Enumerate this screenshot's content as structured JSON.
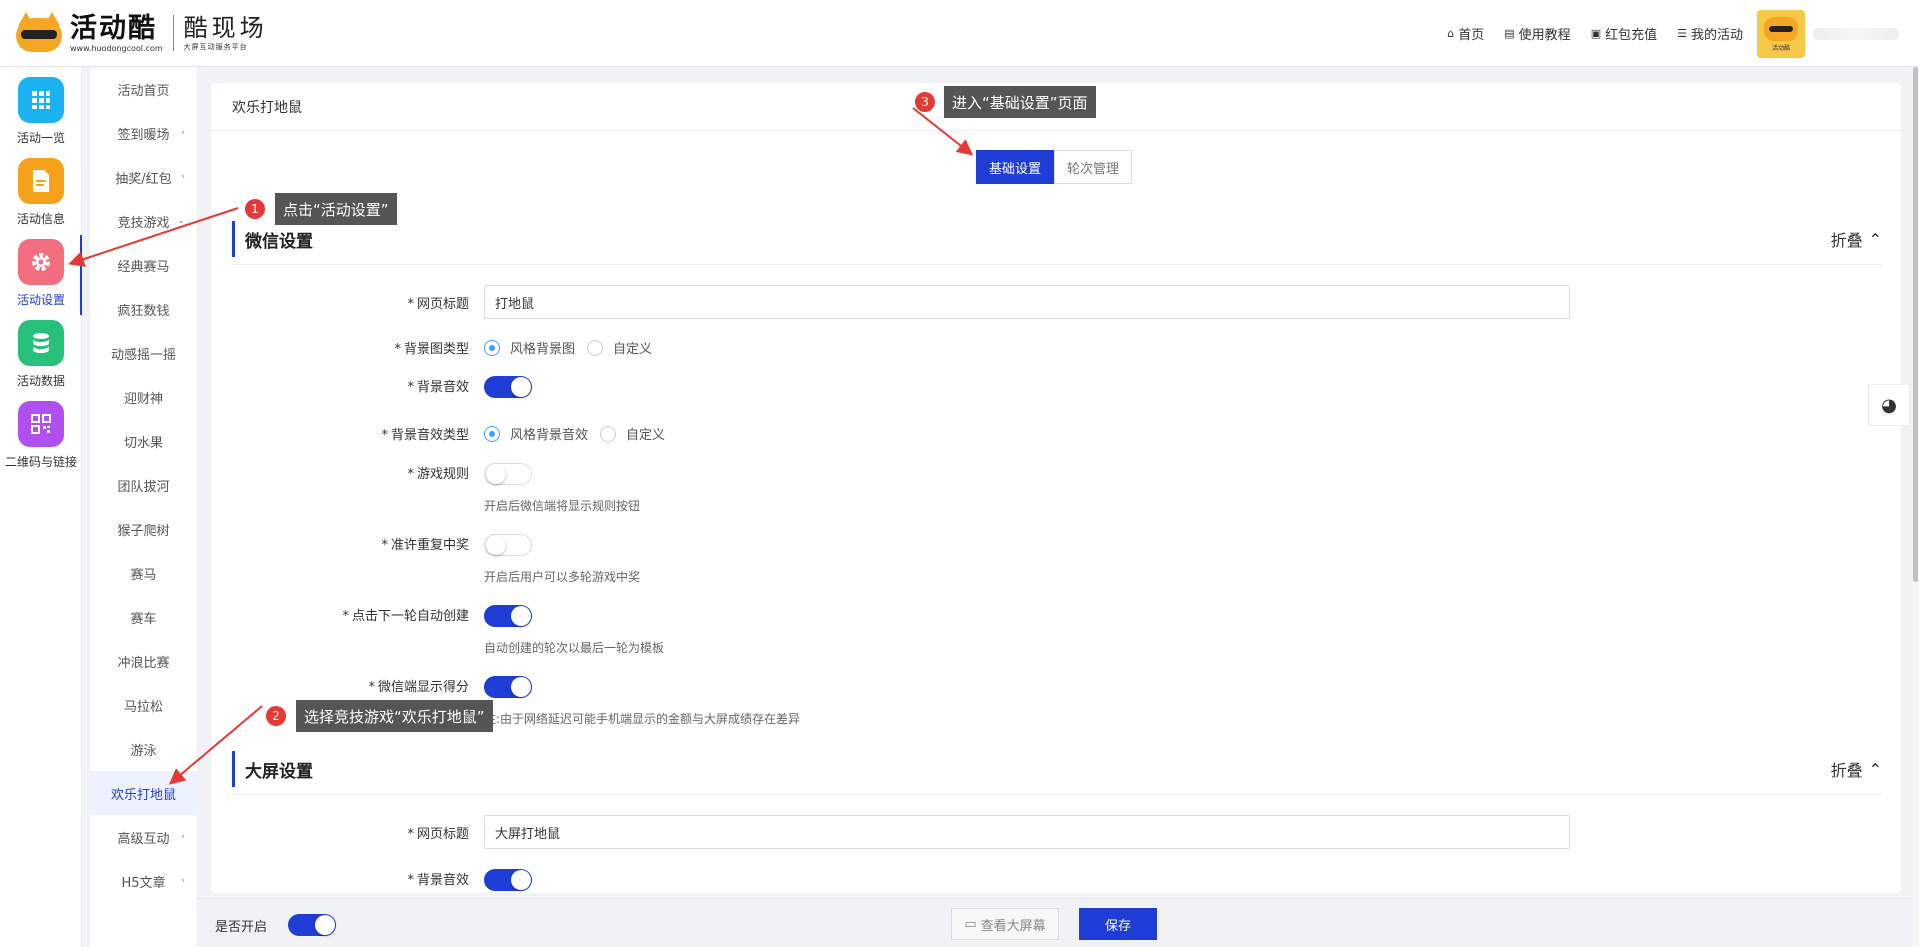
{
  "header": {
    "logo_text": "活动酷",
    "logo_url": "www.huodongcool.com",
    "logo_sub": "酷现场",
    "logo_sub_small": "大屏互动服务平台",
    "nav": [
      {
        "label": "首页",
        "icon": "home-icon"
      },
      {
        "label": "使用教程",
        "icon": "book-icon"
      },
      {
        "label": "红包充值",
        "icon": "wallet-icon"
      },
      {
        "label": "我的活动",
        "icon": "list-icon"
      }
    ],
    "avatar_label": "活动酷"
  },
  "sidebar": {
    "items": [
      {
        "label": "活动一览",
        "icon": "grid-icon",
        "color": "#1ab2f0"
      },
      {
        "label": "活动信息",
        "icon": "document-icon",
        "color": "#f7a21b"
      },
      {
        "label": "活动设置",
        "icon": "gear-icon",
        "color": "#f26d7d"
      },
      {
        "label": "活动数据",
        "icon": "database-icon",
        "color": "#27c07b"
      },
      {
        "label": "二维码与链接",
        "icon": "qrcode-icon",
        "color": "#b14ff0"
      }
    ]
  },
  "subnav": {
    "items": [
      {
        "label": "活动首页",
        "arrow": ""
      },
      {
        "label": "签到暖场",
        "arrow": "›"
      },
      {
        "label": "抽奖/红包",
        "arrow": "›"
      },
      {
        "label": "竞技游戏",
        "arrow": "⌄"
      },
      {
        "label": "经典赛马",
        "arrow": ""
      },
      {
        "label": "疯狂数钱",
        "arrow": ""
      },
      {
        "label": "动感摇一摇",
        "arrow": ""
      },
      {
        "label": "迎财神",
        "arrow": ""
      },
      {
        "label": "切水果",
        "arrow": ""
      },
      {
        "label": "团队拔河",
        "arrow": ""
      },
      {
        "label": "猴子爬树",
        "arrow": ""
      },
      {
        "label": "赛马",
        "arrow": ""
      },
      {
        "label": "赛车",
        "arrow": ""
      },
      {
        "label": "冲浪比赛",
        "arrow": ""
      },
      {
        "label": "马拉松",
        "arrow": ""
      },
      {
        "label": "游泳",
        "arrow": ""
      },
      {
        "label": "欢乐打地鼠",
        "arrow": ""
      },
      {
        "label": "高级互动",
        "arrow": "›"
      },
      {
        "label": "H5文章",
        "arrow": "›"
      }
    ]
  },
  "panel": {
    "title": "欢乐打地鼠",
    "tabs": [
      "基础设置",
      "轮次管理"
    ],
    "wechat": {
      "section_title": "微信设置",
      "fold_label": "折叠",
      "page_title_label": "网页标题",
      "page_title_value": "打地鼠",
      "bg_type_label": "背景图类型",
      "bg_type_options": [
        "风格背景图",
        "自定义"
      ],
      "bg_sound_label": "背景音效",
      "bg_sound_type_label": "背景音效类型",
      "bg_sound_type_options": [
        "风格背景音效",
        "自定义"
      ],
      "rules_label": "游戏规则",
      "rules_hint": "开启后微信端将显示规则按钮",
      "repeat_label": "准许重复中奖",
      "repeat_hint": "开启后用户可以多轮游戏中奖",
      "auto_next_label": "点击下一轮自动创建",
      "auto_next_hint": "自动创建的轮次以最后一轮为模板",
      "show_score_label": "微信端显示得分",
      "show_score_hint": "注:由于网络延迟可能手机端显示的金额与大屏成绩存在差异"
    },
    "bigscreen": {
      "section_title": "大屏设置",
      "fold_label": "折叠",
      "page_title_label": "网页标题",
      "page_title_value": "大屏打地鼠",
      "bg_sound_label": "背景音效"
    }
  },
  "bottom": {
    "enable_label": "是否开启",
    "view_label": "查看大屏幕",
    "save_label": "保存"
  },
  "annotations": [
    {
      "num": "1",
      "text": "点击“活动设置”"
    },
    {
      "num": "2",
      "text": "选择竞技游戏“欢乐打地鼠”"
    },
    {
      "num": "3",
      "text": "进入“基础设置”页面"
    }
  ],
  "colors": {
    "accent": "#1f3dd6",
    "annotation_bg": "#555555",
    "badge": "#e53935"
  }
}
